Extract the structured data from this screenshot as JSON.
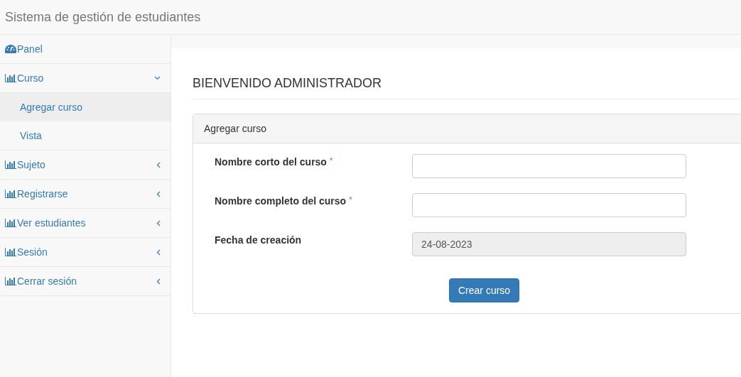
{
  "header": {
    "title": "Sistema de gestión de estudiantes"
  },
  "sidebar": {
    "items": [
      {
        "label": "Panel",
        "kind": "gauge"
      },
      {
        "label": "Curso",
        "kind": "chart",
        "expanded": true,
        "children": [
          {
            "label": "Agregar curso",
            "selected": true
          },
          {
            "label": "Vista",
            "selected": false
          }
        ]
      },
      {
        "label": "Sujeto",
        "kind": "chart",
        "expanded": false
      },
      {
        "label": "Registrarse",
        "kind": "chart",
        "expanded": false
      },
      {
        "label": "Ver estudiantes",
        "kind": "chart",
        "expanded": false
      },
      {
        "label": "Sesión",
        "kind": "chart",
        "expanded": false
      },
      {
        "label": "Cerrar sesión",
        "kind": "chart",
        "expanded": false
      }
    ]
  },
  "heading": "BIENVENIDO ADMINISTRADOR",
  "panel": {
    "title": "Agregar curso",
    "fields": [
      {
        "label": "Nombre corto del curso",
        "required_mark": "*",
        "disabled": false
      },
      {
        "label": "Nombre completo del curso",
        "required_mark": "*",
        "disabled": false
      },
      {
        "label": "Fecha de creación",
        "value": "24-08-2023",
        "disabled": true
      }
    ],
    "button": "Crear curso"
  }
}
